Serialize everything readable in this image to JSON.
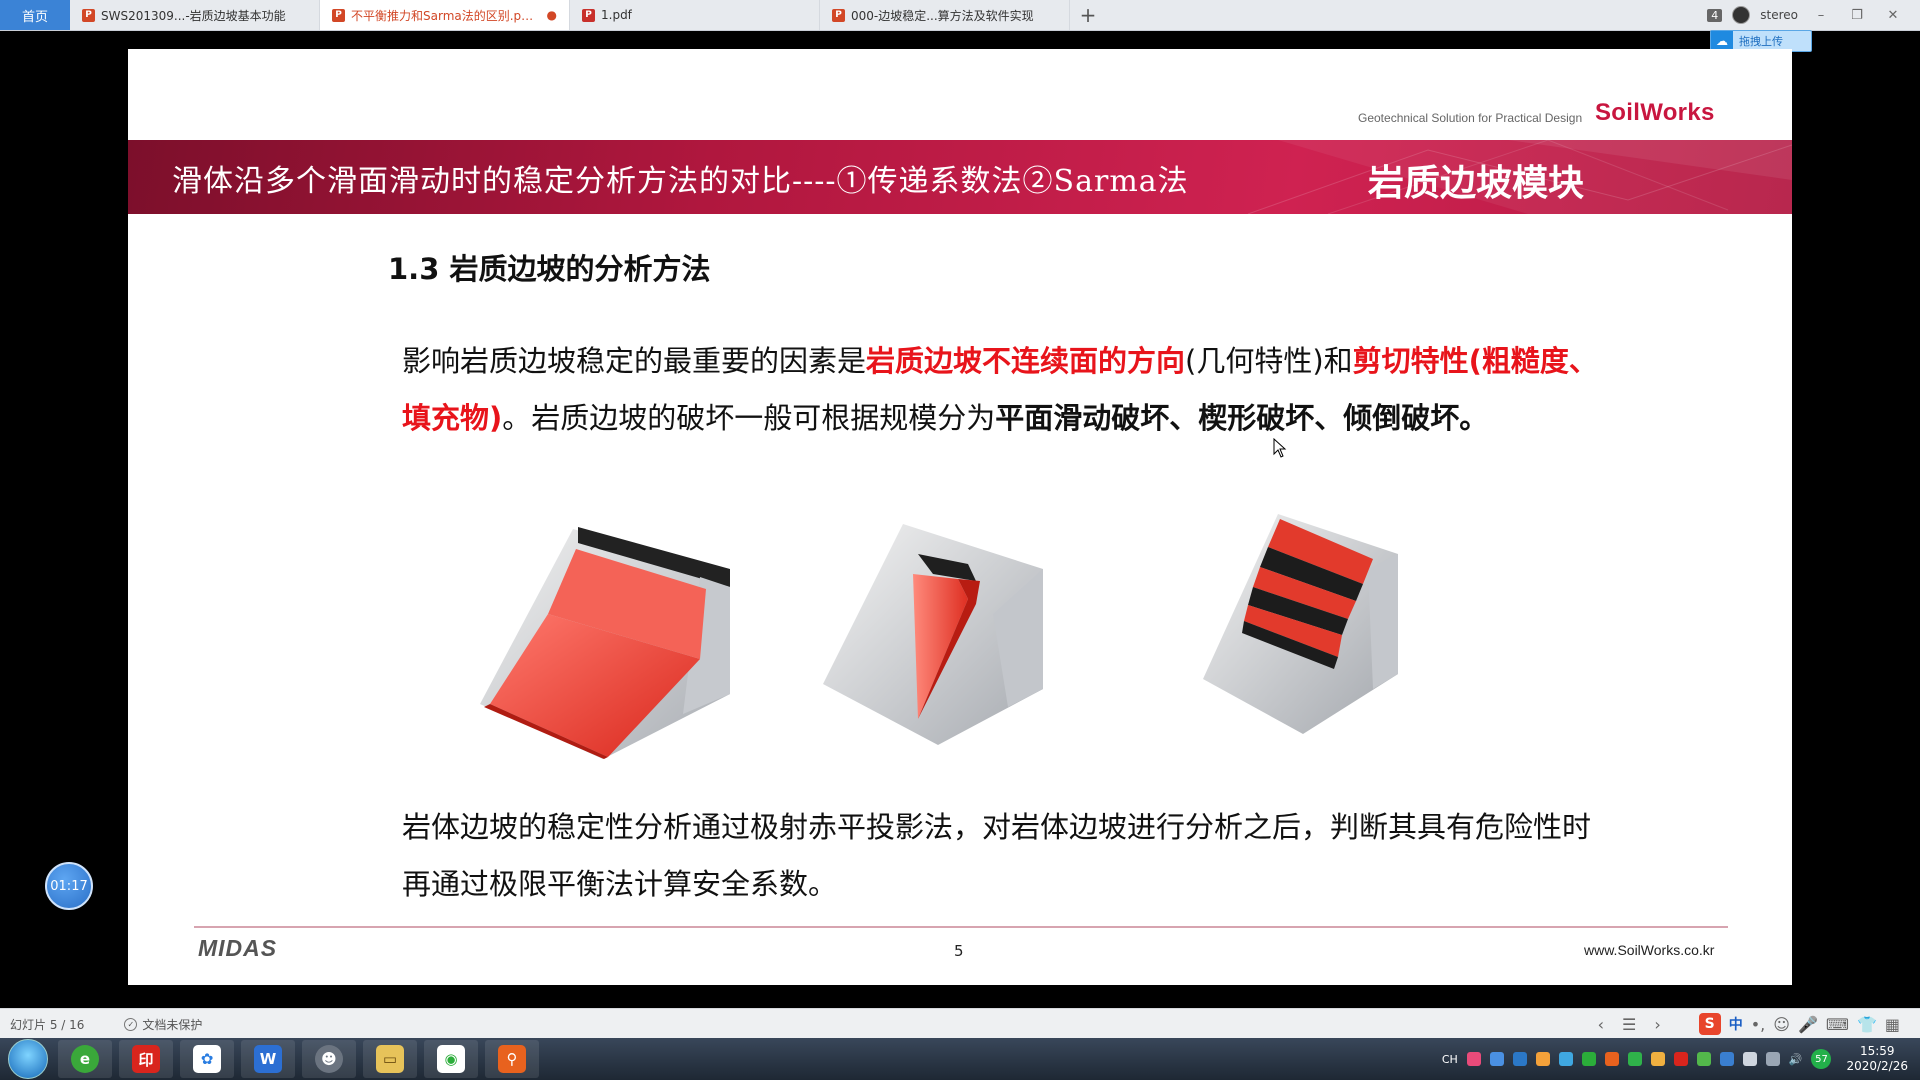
{
  "tabs": {
    "home": "首页",
    "items": [
      {
        "label": "SWS201309...-岩质边坡基本功能",
        "type": "ppt",
        "active": false,
        "modified": false
      },
      {
        "label": "不平衡推力和Sarma法的区别.pptx",
        "type": "ppt",
        "active": true,
        "modified": true
      },
      {
        "label": "1.pdf",
        "type": "pdf",
        "active": false,
        "modified": false
      },
      {
        "label": "000-边坡稳定...算方法及软件实现",
        "type": "ppt",
        "active": false,
        "modified": false
      }
    ],
    "add": "+",
    "window_count": "4",
    "user": "stereo",
    "modified_mark": "●"
  },
  "upload_button": "拖拽上传",
  "slide": {
    "tagline": "Geotechnical Solution for Practical Design",
    "brand": "SoilWorks",
    "banner_title": "滑体沿多个滑面滑动时的稳定分析方法的对比----①传递系数法②Sarma法",
    "banner_module": "岩质边坡模块",
    "heading": "1.3 岩质边坡的分析方法",
    "para1": {
      "p1": "影响岩质边坡稳定的最重要的因素是",
      "r1": "岩质边坡不连续面的方向",
      "p2": "(几何特性)和",
      "r2": "剪切特性(粗糙度、填充物)",
      "p3": "。岩质边坡的破坏一般可根据规模分为",
      "b1": "平面滑动破坏、楔形破坏、倾倒破坏。"
    },
    "para2": "岩体边坡的稳定性分析通过极射赤平投影法，对岩体边坡进行分析之后，判断其具有危险性时再通过极限平衡法计算安全系数。",
    "footer_logo": "MIDAS",
    "page_number": "5",
    "footer_url": "www.SoilWorks.co.kr"
  },
  "timer": "01:17",
  "statusbar": {
    "slide_count": "幻灯片 5 / 16",
    "protection": "文档未保护",
    "ime_zh": "中"
  },
  "taskbar": {
    "ime_indicator": "CH",
    "network_badge": "57",
    "time": "15:59",
    "date": "2020/2/26"
  },
  "colors": {
    "accent_red": "#e8141b",
    "banner": "#b0173e",
    "brand": "#c8163f",
    "active_tab_text": "#d24726"
  }
}
